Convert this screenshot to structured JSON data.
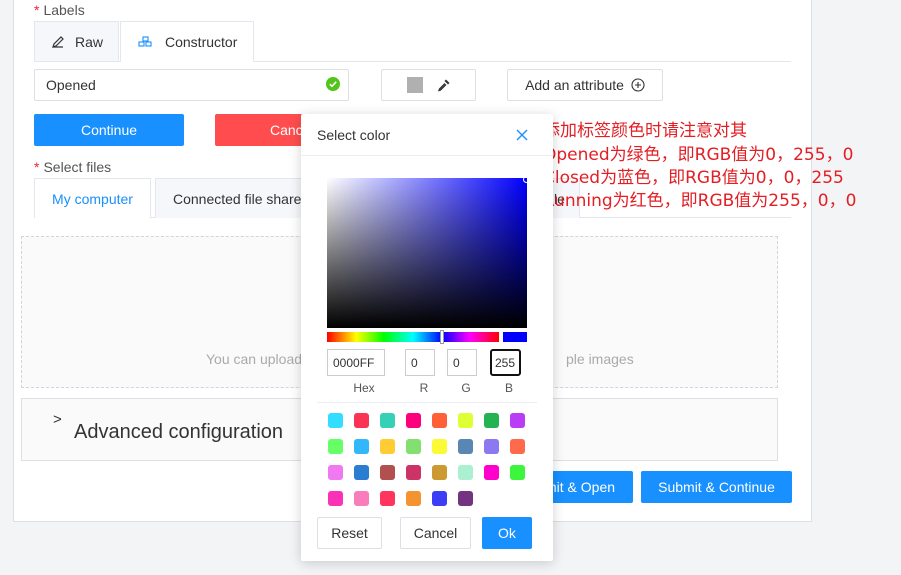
{
  "labels_section": {
    "required_mark": "*",
    "title": "Labels",
    "tabs": [
      {
        "label": "Raw",
        "icon": "pencil-icon"
      },
      {
        "label": "Constructor",
        "icon": "blocks-icon"
      }
    ],
    "label_name_value": "Opened",
    "add_attribute_label": "Add an attribute"
  },
  "buttons": {
    "continue": "Continue",
    "cancel": "Canc",
    "submit_open": "mit & Open",
    "submit_continue": "Submit & Continue"
  },
  "files_section": {
    "required_mark": "*",
    "title": "Select files",
    "tabs": [
      "My computer",
      "Connected file share"
    ],
    "tab_fragment": "le",
    "dropzone_text_left": "You can upload",
    "dropzone_text_right": "ple images"
  },
  "advanced": {
    "chevron": ">",
    "title": "Advanced configuration"
  },
  "annotation": {
    "lines": [
      "添加标签颜色时请注意对其",
      "Opened为绿色，即RGB值为0，255，0",
      "Closed为蓝色，即RGB值为0，0，255",
      "Running为红色，即RGB值为255，0，0"
    ],
    "color": "#e31e24"
  },
  "color_picker": {
    "title": "Select color",
    "hex_value": "0000FF",
    "r_value": "0",
    "g_value": "0",
    "b_value": "255",
    "hex_label": "Hex",
    "r_label": "R",
    "g_label": "G",
    "b_label": "B",
    "swatches": [
      "#33ddff",
      "#fa3253",
      "#34d1b7",
      "#ff007c",
      "#ff6037",
      "#ddff33",
      "#24b353",
      "#b83df5",
      "#66ff66",
      "#32b7fa",
      "#ffcc33",
      "#83e070",
      "#fafa37",
      "#5986b3",
      "#8c78f0",
      "#ff6a4d",
      "#f078f0",
      "#2a7dd1",
      "#b25050",
      "#cc3366",
      "#cc9933",
      "#aaf0d1",
      "#ff00cc",
      "#3df53d",
      "#fa32b7",
      "#fa7dbb",
      "#ff355e",
      "#f59331",
      "#3d3df5",
      "#733380"
    ],
    "reset_label": "Reset",
    "cancel_label": "Cancel",
    "ok_label": "Ok"
  },
  "colors": {
    "primary": "#1890ff",
    "danger": "#ff4d4f",
    "success": "#52c41a"
  }
}
